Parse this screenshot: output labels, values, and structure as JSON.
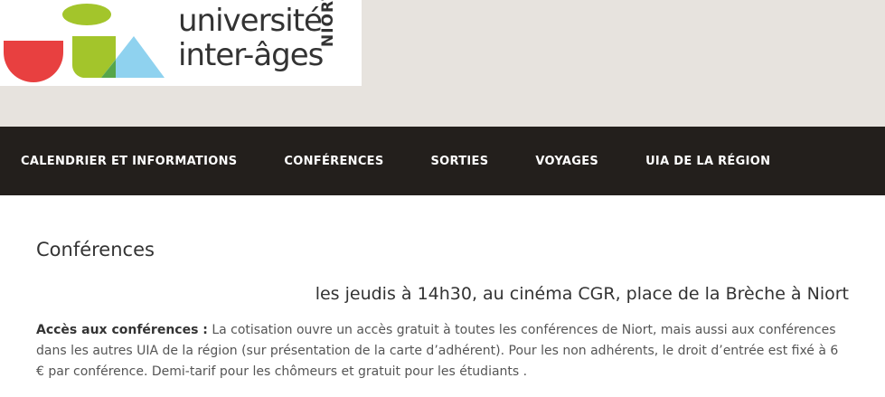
{
  "logo": {
    "line1": "université",
    "line2": "inter-âges",
    "city": "NIORT",
    "colors": {
      "red": "#e84040",
      "green": "#a3c52b",
      "blue": "#8fd2ef",
      "darkgreen": "#56a64a"
    }
  },
  "nav": {
    "items": [
      {
        "label": "CALENDRIER ET INFORMATIONS"
      },
      {
        "label": "CONFÉRENCES"
      },
      {
        "label": "SORTIES"
      },
      {
        "label": "VOYAGES"
      },
      {
        "label": "UIA DE LA RÉGION"
      }
    ]
  },
  "main": {
    "title": "Conférences",
    "subtitle": "les jeudis à 14h30, au cinéma CGR, place de la Brèche à Niort",
    "access_label": "Accès aux conférences :",
    "access_text": " La cotisation ouvre un accès gratuit à toutes les conférences de Niort, mais aussi aux conférences dans les autres UIA de la région (sur présentation de la carte d’adhérent). Pour les non adhérents, le droit d’entrée est fixé à 6 € par conférence. Demi-tarif pour les chômeurs et gratuit pour les étudiants ."
  },
  "colors": {
    "nav_bg": "#231f1c",
    "header_bg": "#e7e3de"
  }
}
